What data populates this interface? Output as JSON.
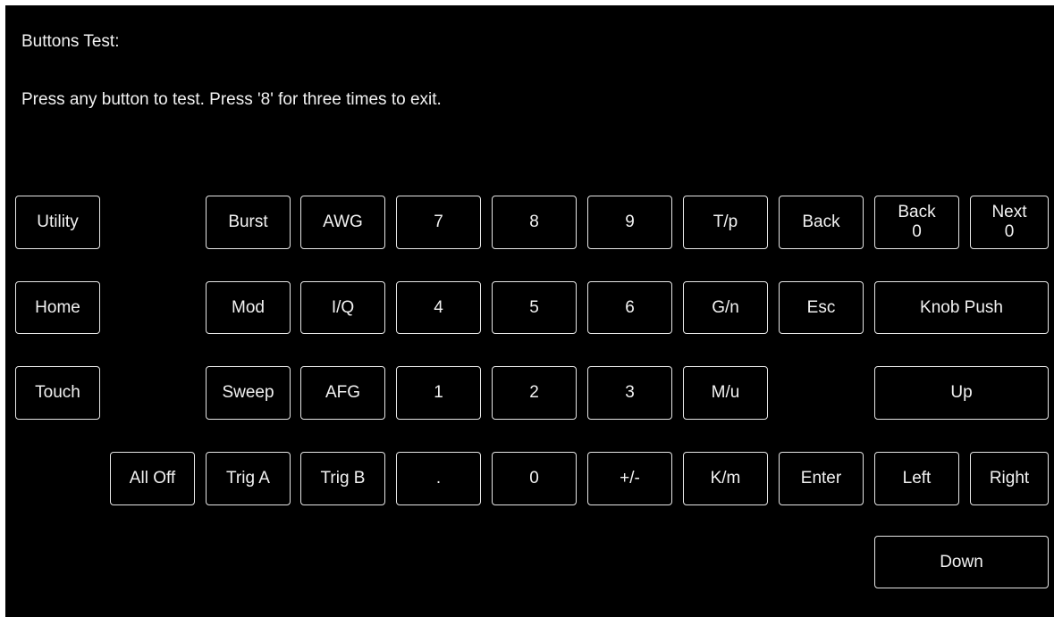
{
  "screen": {
    "title": "Buttons Test:",
    "instructions": "Press any button to test. Press '8' for three times to exit."
  },
  "buttons": {
    "utility": "Utility",
    "home": "Home",
    "touch": "Touch",
    "all_off": "All Off",
    "burst": "Burst",
    "mod": "Mod",
    "sweep": "Sweep",
    "trig_a": "Trig A",
    "awg": "AWG",
    "iq": "I/Q",
    "afg": "AFG",
    "trig_b": "Trig B",
    "num7": "7",
    "num4": "4",
    "num1": "1",
    "dot": ".",
    "num8": "8",
    "num5": "5",
    "num2": "2",
    "num0": "0",
    "num9": "9",
    "num6": "6",
    "num3": "3",
    "plus_minus": "+/-",
    "tp": "T/p",
    "gn": "G/n",
    "mu": "M/u",
    "km": "K/m",
    "back": "Back",
    "esc": "Esc",
    "enter": "Enter",
    "back_counter": {
      "label": "Back",
      "count": "0"
    },
    "next_counter": {
      "label": "Next",
      "count": "0"
    },
    "knob_push": "Knob Push",
    "up": "Up",
    "left": "Left",
    "right": "Right",
    "down": "Down"
  }
}
